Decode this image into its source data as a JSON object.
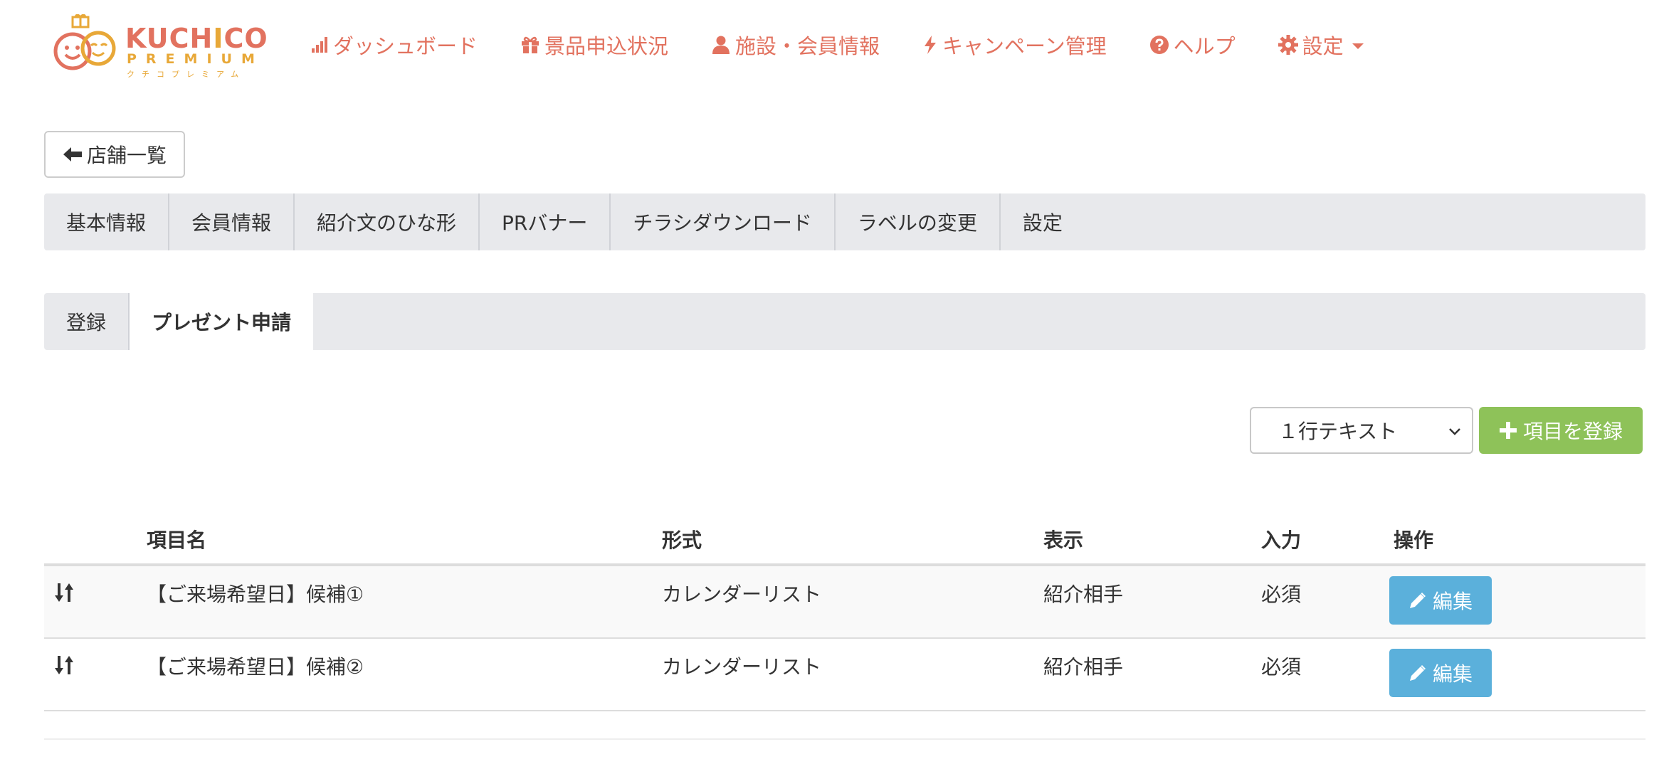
{
  "logo": {
    "name_a": "KUCH",
    "name_b": "I",
    "name_c": "CO",
    "sub": "PREMIUM",
    "kana": "クチコプレミアム",
    "color_a": "#e2725f",
    "color_b": "#e8a838"
  },
  "nav": {
    "items": [
      {
        "label": "ダッシュボード",
        "icon": "bar-chart-icon"
      },
      {
        "label": "景品申込状況",
        "icon": "gift-icon"
      },
      {
        "label": "施設・会員情報",
        "icon": "user-icon"
      },
      {
        "label": "キャンペーン管理",
        "icon": "bolt-icon"
      },
      {
        "label": "ヘルプ",
        "icon": "question-circle-icon"
      },
      {
        "label": "設定",
        "icon": "gear-icon"
      }
    ]
  },
  "back_button": {
    "label": "店舗一覧",
    "icon": "arrow-left-icon"
  },
  "main_tabs": [
    {
      "label": "基本情報"
    },
    {
      "label": "会員情報"
    },
    {
      "label": "紹介文のひな形"
    },
    {
      "label": "PRバナー"
    },
    {
      "label": "チラシダウンロード"
    },
    {
      "label": "ラベルの変更"
    },
    {
      "label": "設定"
    }
  ],
  "sub_tabs": [
    {
      "label": "登録",
      "active": false
    },
    {
      "label": "プレゼント申請",
      "active": true
    }
  ],
  "toolbar": {
    "select_value": "１行テキスト",
    "add_label": "項目を登録"
  },
  "table": {
    "headers": [
      "項目名",
      "形式",
      "表示",
      "入力",
      "操作"
    ],
    "rows": [
      {
        "name": "【ご来場希望日】候補①",
        "type": "カレンダーリスト",
        "display": "紹介相手",
        "input": "必須",
        "action": "編集"
      },
      {
        "name": "【ご来場希望日】候補②",
        "type": "カレンダーリスト",
        "display": "紹介相手",
        "input": "必須",
        "action": "編集"
      }
    ]
  },
  "colors": {
    "nav": "#e2725f",
    "add_button": "#8ec259",
    "edit_button": "#5bb0db",
    "tab_bg": "#e8e9ec"
  }
}
